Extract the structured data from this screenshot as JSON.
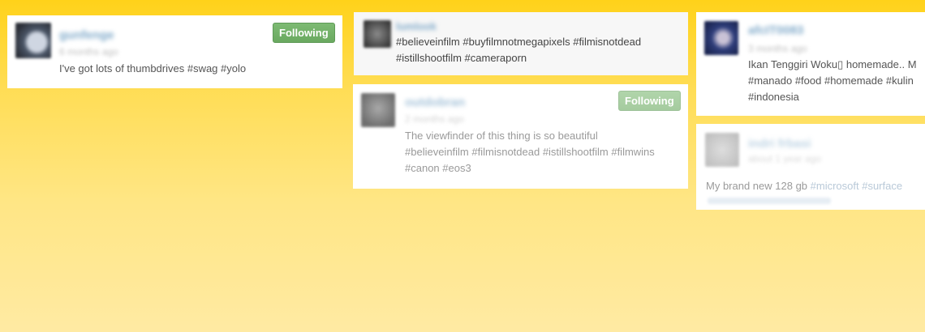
{
  "feed": {
    "column1": {
      "card1": {
        "username": "gunfenge",
        "timestamp": "6 months ago",
        "follow_label": "Following",
        "text": "I've got lots of thumbdrives #swag #yolo"
      }
    },
    "column2": {
      "card1": {
        "username": "lumlook",
        "text_line1": "#believeinfilm #buyfilmnotmegapixels #filmisnotdead",
        "text_line2": "#istillshootfilm #cameraporn"
      },
      "card2": {
        "username": "outdobran",
        "timestamp": "2 months ago",
        "follow_label": "Following",
        "text_line1": "The viewfinder of this thing is so beautiful",
        "text_line2": "#believeinfilm #filmisnotdead #istillshootfilm #filmwins",
        "text_line3": "#canon #eos3"
      }
    },
    "column3": {
      "card1": {
        "username": "afcIT0083",
        "timestamp": "3 months ago",
        "text_line1": "Ikan Tenggiri Woku▯ homemade.. M",
        "text_line2": "#manado #food #homemade #kulin",
        "text_line3": "#indonesia"
      },
      "card2": {
        "username": "indri frbasi",
        "timestamp": "about 1 year ago",
        "text_prefix": "My brand new 128 gb ",
        "text_tags": "#microsoft #surface"
      }
    }
  },
  "colors": {
    "background_top": "#ffd21a",
    "background_bottom": "#ffeaa3",
    "follow_button": "#6aa960",
    "username_link": "#7fa9c9"
  }
}
